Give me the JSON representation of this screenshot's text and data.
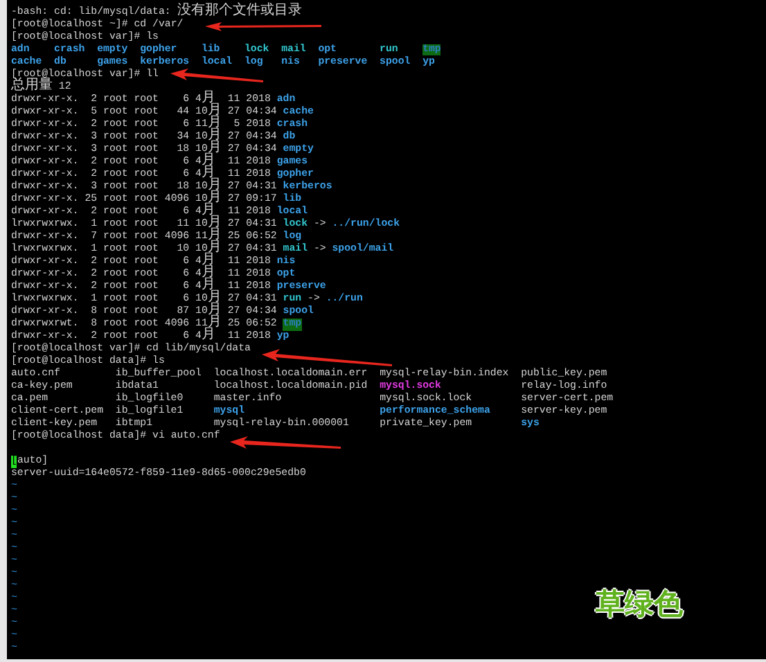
{
  "terminal": {
    "lines": [
      {
        "kind": "text",
        "segments": [
          {
            "text": "-bash: cd: lib/mysql/data: 没有那个文件或目录",
            "kind": "plain"
          }
        ]
      },
      {
        "kind": "text",
        "segments": [
          {
            "text": "[root@localhost ~]# cd /var/",
            "kind": "plain"
          }
        ]
      },
      {
        "kind": "text",
        "segments": [
          {
            "text": "[root@localhost var]# ls",
            "kind": "plain"
          }
        ]
      },
      {
        "kind": "grid",
        "rows": [
          [
            {
              "text": "adn",
              "kind": "dir"
            },
            {
              "text": "crash",
              "kind": "dir"
            },
            {
              "text": "empty",
              "kind": "dir"
            },
            {
              "text": "gopher",
              "kind": "dir"
            },
            {
              "text": "lib",
              "kind": "dir"
            },
            {
              "text": "lock",
              "kind": "link"
            },
            {
              "text": "mail",
              "kind": "link"
            },
            {
              "text": "opt",
              "kind": "dir"
            },
            {
              "text": "run",
              "kind": "link"
            },
            {
              "text": "tmp",
              "kind": "sticky"
            }
          ],
          [
            {
              "text": "cache",
              "kind": "dir"
            },
            {
              "text": "db",
              "kind": "dir"
            },
            {
              "text": "games",
              "kind": "dir"
            },
            {
              "text": "kerberos",
              "kind": "dir"
            },
            {
              "text": "local",
              "kind": "dir"
            },
            {
              "text": "log",
              "kind": "dir"
            },
            {
              "text": "nis",
              "kind": "dir"
            },
            {
              "text": "preserve",
              "kind": "dir"
            },
            {
              "text": "spool",
              "kind": "dir"
            },
            {
              "text": "yp",
              "kind": "dir"
            }
          ]
        ]
      },
      {
        "kind": "text",
        "segments": [
          {
            "text": "[root@localhost var]# ll",
            "kind": "plain"
          }
        ]
      },
      {
        "kind": "text",
        "segments": [
          {
            "text": "总用量 12",
            "kind": "plain"
          }
        ]
      },
      {
        "kind": "text",
        "segments": [
          {
            "text": "drwxr-xr-x.  2 root root    6 4月  11 2018",
            "kind": "plain"
          },
          {
            "text": "adn",
            "kind": "dir"
          }
        ]
      },
      {
        "kind": "text",
        "segments": [
          {
            "text": "drwxr-xr-x.  5 root root   44 10月 27 04:34",
            "kind": "plain"
          },
          {
            "text": "cache",
            "kind": "dir"
          }
        ]
      },
      {
        "kind": "text",
        "segments": [
          {
            "text": "drwxr-xr-x.  2 root root    6 11月  5 2018",
            "kind": "plain"
          },
          {
            "text": "crash",
            "kind": "dir"
          }
        ]
      },
      {
        "kind": "text",
        "segments": [
          {
            "text": "drwxr-xr-x.  3 root root   34 10月 27 04:34",
            "kind": "plain"
          },
          {
            "text": "db",
            "kind": "dir"
          }
        ]
      },
      {
        "kind": "text",
        "segments": [
          {
            "text": "drwxr-xr-x.  3 root root   18 10月 27 04:34",
            "kind": "plain"
          },
          {
            "text": "empty",
            "kind": "dir"
          }
        ]
      },
      {
        "kind": "text",
        "segments": [
          {
            "text": "drwxr-xr-x.  2 root root    6 4月  11 2018",
            "kind": "plain"
          },
          {
            "text": "games",
            "kind": "dir"
          }
        ]
      },
      {
        "kind": "text",
        "segments": [
          {
            "text": "drwxr-xr-x.  2 root root    6 4月  11 2018",
            "kind": "plain"
          },
          {
            "text": "gopher",
            "kind": "dir"
          }
        ]
      },
      {
        "kind": "text",
        "segments": [
          {
            "text": "drwxr-xr-x.  3 root root   18 10月 27 04:31",
            "kind": "plain"
          },
          {
            "text": "kerberos",
            "kind": "dir"
          }
        ]
      },
      {
        "kind": "text",
        "segments": [
          {
            "text": "drwxr-xr-x. 25 root root 4096 10月 27 09:17",
            "kind": "plain"
          },
          {
            "text": "lib",
            "kind": "dir"
          }
        ]
      },
      {
        "kind": "text",
        "segments": [
          {
            "text": "drwxr-xr-x.  2 root root    6 4月  11 2018",
            "kind": "plain"
          },
          {
            "text": "local",
            "kind": "dir"
          }
        ]
      },
      {
        "kind": "text",
        "segments": [
          {
            "text": "lrwxrwxrwx.  1 root root   11 10月 27 04:31",
            "kind": "plain"
          },
          {
            "text": "lock",
            "kind": "link"
          },
          {
            "text": "->",
            "kind": "plain"
          },
          {
            "text": "../run/lock",
            "kind": "dir"
          }
        ]
      },
      {
        "kind": "text",
        "segments": [
          {
            "text": "drwxr-xr-x.  7 root root 4096 11月 25 06:52",
            "kind": "plain"
          },
          {
            "text": "log",
            "kind": "dir"
          }
        ]
      },
      {
        "kind": "text",
        "segments": [
          {
            "text": "lrwxrwxrwx.  1 root root   10 10月 27 04:31",
            "kind": "plain"
          },
          {
            "text": "mail",
            "kind": "link"
          },
          {
            "text": "->",
            "kind": "plain"
          },
          {
            "text": "spool/mail",
            "kind": "dir"
          }
        ]
      },
      {
        "kind": "text",
        "segments": [
          {
            "text": "drwxr-xr-x.  2 root root    6 4月  11 2018",
            "kind": "plain"
          },
          {
            "text": "nis",
            "kind": "dir"
          }
        ]
      },
      {
        "kind": "text",
        "segments": [
          {
            "text": "drwxr-xr-x.  2 root root    6 4月  11 2018",
            "kind": "plain"
          },
          {
            "text": "opt",
            "kind": "dir"
          }
        ]
      },
      {
        "kind": "text",
        "segments": [
          {
            "text": "drwxr-xr-x.  2 root root    6 4月  11 2018",
            "kind": "plain"
          },
          {
            "text": "preserve",
            "kind": "dir"
          }
        ]
      },
      {
        "kind": "text",
        "segments": [
          {
            "text": "lrwxrwxrwx.  1 root root    6 10月 27 04:31",
            "kind": "plain"
          },
          {
            "text": "run",
            "kind": "link"
          },
          {
            "text": "->",
            "kind": "plain"
          },
          {
            "text": "../run",
            "kind": "dir"
          }
        ]
      },
      {
        "kind": "text",
        "segments": [
          {
            "text": "drwxr-xr-x.  8 root root   87 10月 27 04:34",
            "kind": "plain"
          },
          {
            "text": "spool",
            "kind": "dir"
          }
        ]
      },
      {
        "kind": "text",
        "segments": [
          {
            "text": "drwxrwxrwt.  8 root root 4096 11月 25 06:52",
            "kind": "plain"
          },
          {
            "text": "tmp",
            "kind": "sticky"
          }
        ]
      },
      {
        "kind": "text",
        "segments": [
          {
            "text": "drwxr-xr-x.  2 root root    6 4月  11 2018",
            "kind": "plain"
          },
          {
            "text": "yp",
            "kind": "dir"
          }
        ]
      },
      {
        "kind": "text",
        "segments": [
          {
            "text": "[root@localhost var]# cd lib/mysql/data",
            "kind": "plain"
          }
        ]
      },
      {
        "kind": "text",
        "segments": [
          {
            "text": "[root@localhost data]# ls",
            "kind": "plain"
          }
        ]
      },
      {
        "kind": "grid",
        "rows": [
          [
            {
              "text": "auto.cnf",
              "kind": "file"
            },
            {
              "text": "ib_buffer_pool",
              "kind": "file"
            },
            {
              "text": "localhost.localdomain.err",
              "kind": "file"
            },
            {
              "text": "mysql-relay-bin.index",
              "kind": "file"
            },
            {
              "text": "public_key.pem",
              "kind": "file"
            }
          ],
          [
            {
              "text": "ca-key.pem",
              "kind": "file"
            },
            {
              "text": "ibdata1",
              "kind": "file"
            },
            {
              "text": "localhost.localdomain.pid",
              "kind": "file"
            },
            {
              "text": "mysql.sock",
              "kind": "socket"
            },
            {
              "text": "relay-log.info",
              "kind": "file"
            }
          ],
          [
            {
              "text": "ca.pem",
              "kind": "file"
            },
            {
              "text": "ib_logfile0",
              "kind": "file"
            },
            {
              "text": "master.info",
              "kind": "file"
            },
            {
              "text": "mysql.sock.lock",
              "kind": "file"
            },
            {
              "text": "server-cert.pem",
              "kind": "file"
            }
          ],
          [
            {
              "text": "client-cert.pem",
              "kind": "file"
            },
            {
              "text": "ib_logfile1",
              "kind": "file"
            },
            {
              "text": "mysql",
              "kind": "dir"
            },
            {
              "text": "performance_schema",
              "kind": "dir"
            },
            {
              "text": "server-key.pem",
              "kind": "file"
            }
          ],
          [
            {
              "text": "client-key.pem",
              "kind": "file"
            },
            {
              "text": "ibtmp1",
              "kind": "file"
            },
            {
              "text": "mysql-relay-bin.000001",
              "kind": "file"
            },
            {
              "text": "private_key.pem",
              "kind": "file"
            },
            {
              "text": "sys",
              "kind": "dir"
            }
          ]
        ]
      },
      {
        "kind": "text",
        "segments": [
          {
            "text": "[root@localhost data]# vi auto.cnf",
            "kind": "plain"
          }
        ]
      },
      {
        "kind": "blank"
      },
      {
        "kind": "text",
        "segments": [
          {
            "text": "[",
            "kind": "cursor"
          },
          {
            "text": "auto]",
            "kind": "plain"
          }
        ]
      },
      {
        "kind": "text",
        "segments": [
          {
            "text": "server-uuid=164e0572-f859-11e9-8d65-000c29e5edb0",
            "kind": "plain"
          }
        ]
      }
    ],
    "empty_buffer_lines": [
      "~",
      "~",
      "~",
      "~",
      "~",
      "~",
      "~",
      "~",
      "~",
      "~",
      "~",
      "~",
      "~",
      "~"
    ]
  },
  "annotation": {
    "text": "草绿色"
  }
}
